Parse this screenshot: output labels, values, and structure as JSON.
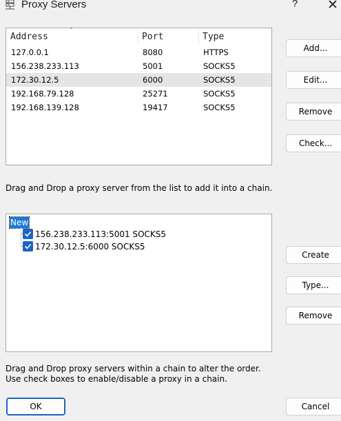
{
  "window": {
    "title": "Proxy Servers",
    "help_label": "?",
    "close_label": "✕"
  },
  "list": {
    "headers": {
      "address": "Address",
      "port": "Port",
      "type": "Type"
    },
    "sort_indicator": "ˆ",
    "rows": [
      {
        "address": "127.0.0.1",
        "port": "8080",
        "type": "HTTPS",
        "selected": false
      },
      {
        "address": "156.238.233.113",
        "port": "5001",
        "type": "SOCKS5",
        "selected": false
      },
      {
        "address": "172.30.12.5",
        "port": "6000",
        "type": "SOCKS5",
        "selected": true
      },
      {
        "address": "192.168.79.128",
        "port": "25271",
        "type": "SOCKS5",
        "selected": false
      },
      {
        "address": "192.168.139.128",
        "port": "19417",
        "type": "SOCKS5",
        "selected": false
      }
    ]
  },
  "list_buttons": {
    "add": "Add...",
    "edit": "Edit...",
    "remove": "Remove",
    "check": "Check..."
  },
  "hint_top": "Drag and Drop a proxy server from the list to add it into a chain.",
  "chain": {
    "root": "New",
    "items": [
      {
        "label": "156.238.233.113:5001 SOCKS5",
        "checked": true
      },
      {
        "label": "172.30.12.5:6000 SOCKS5",
        "checked": true
      }
    ]
  },
  "chain_buttons": {
    "create": "Create",
    "type": "Type...",
    "remove": "Remove"
  },
  "hint_bottom_1": "Drag and Drop proxy servers within a chain to alter the order.",
  "hint_bottom_2": "Use check boxes to enable/disable a proxy in a chain.",
  "dialog_buttons": {
    "ok": "OK",
    "cancel": "Cancel"
  },
  "colors": {
    "accent": "#1e63c4",
    "selection": "#e5e5e5",
    "tree_highlight": "#1e78d7"
  }
}
